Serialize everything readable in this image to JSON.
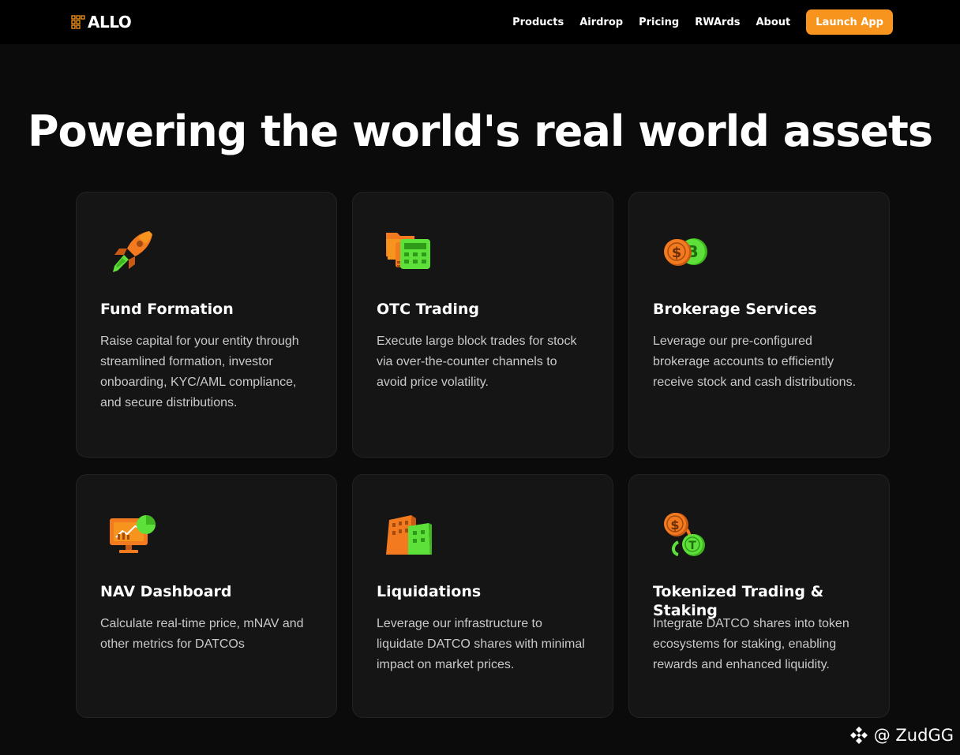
{
  "brand": {
    "name": "ALLO",
    "accent": "#f7941d",
    "green": "#5ee03a"
  },
  "nav": {
    "links": [
      "Products",
      "Airdrop",
      "Pricing",
      "RWArds",
      "About"
    ],
    "cta": "Launch App"
  },
  "hero": {
    "title": "Powering the world's real world assets"
  },
  "cards": [
    {
      "icon": "rocket-icon",
      "title": "Fund Formation",
      "description": "Raise capital for your entity through streamlined formation, investor onboarding, KYC/AML compliance, and secure distributions."
    },
    {
      "icon": "folder-calculator-icon",
      "title": "OTC Trading",
      "description": "Execute large block trades for stock via over-the-counter channels to avoid price volatility."
    },
    {
      "icon": "coins-icon",
      "title": "Brokerage Services",
      "description": "Leverage our pre-configured brokerage accounts to efficiently receive stock and cash distributions."
    },
    {
      "icon": "monitor-chart-icon",
      "title": "NAV Dashboard",
      "description": "Calculate real-time price, mNAV and other metrics for DATCOs"
    },
    {
      "icon": "buildings-icon",
      "title": "Liquidations",
      "description": "Leverage our infrastructure to liquidate DATCO shares with minimal impact on market prices."
    },
    {
      "icon": "linked-coins-icon",
      "title": "Tokenized Trading & Staking",
      "description": "Integrate DATCO shares into token ecosystems for staking, enabling rewards and enhanced liquidity."
    }
  ],
  "watermark": {
    "text": "@ ZudGG",
    "icon": "binance-icon"
  }
}
